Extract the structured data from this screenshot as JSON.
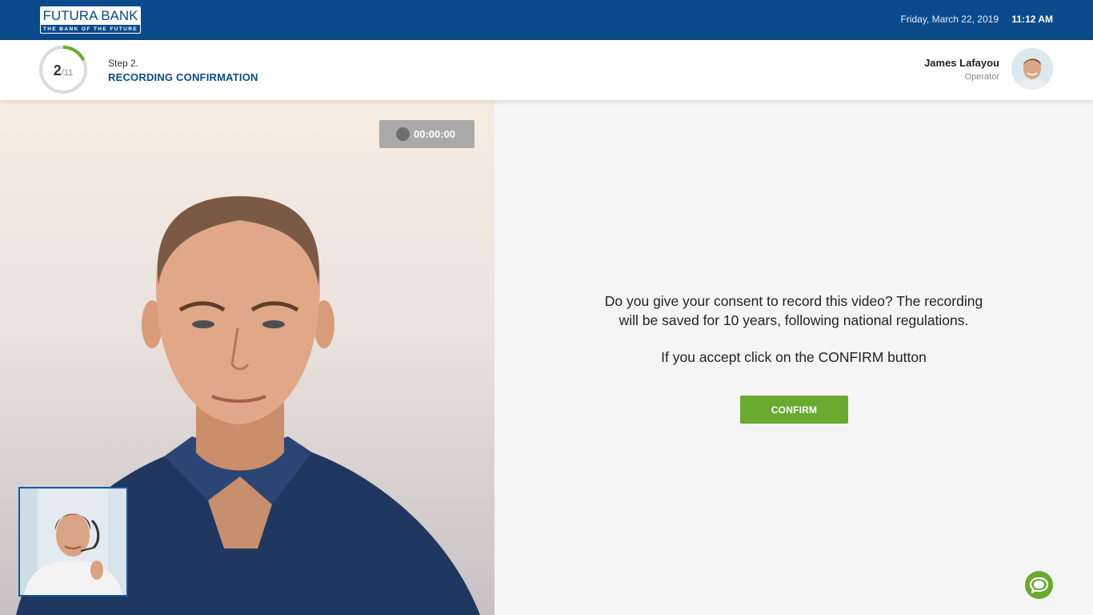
{
  "brand": {
    "name": "FUTURA BANK",
    "tagline": "THE BANK OF THE FUTURE",
    "primary_color": "#0b4a8b",
    "accent_color": "#6aaa2e"
  },
  "header": {
    "date": "Friday, March 22, 2019",
    "time": "11:12 AM"
  },
  "progress": {
    "current": "2",
    "total": "/11",
    "fraction": 0.18
  },
  "step": {
    "label": "Step 2.",
    "title": "RECORDING CONFIRMATION"
  },
  "operator": {
    "name": "James Lafayou",
    "role": "Operator"
  },
  "video": {
    "recording_time": "00:00:00"
  },
  "consent": {
    "line1": "Do you give your consent to record this video? The recording",
    "line2": "will be saved for 10 years, following national regulations.",
    "instruction": "If you accept click on the CONFIRM button",
    "confirm_label": "CONFIRM"
  },
  "icons": {
    "chat": "chat-bubble-icon",
    "record": "record-dot-icon"
  }
}
